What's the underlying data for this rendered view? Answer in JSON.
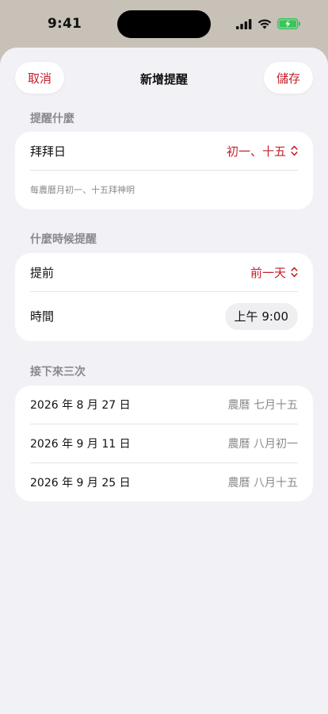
{
  "status": {
    "time": "9:41"
  },
  "nav": {
    "cancel_label": "取消",
    "title": "新增提醒",
    "save_label": "儲存"
  },
  "what_section": {
    "header": "提醒什麼",
    "row_label": "拜拜日",
    "row_value": "初一、十五",
    "hint": "每農曆月初一、十五拜神明"
  },
  "when_section": {
    "header": "什麼時候提醒",
    "advance_label": "提前",
    "advance_value": "前一天",
    "time_label": "時間",
    "time_value": "上午 9:00"
  },
  "next_section": {
    "header": "接下來三次",
    "items": [
      {
        "date": "2026 年 8 月 27 日",
        "lunar": "農曆 七月十五"
      },
      {
        "date": "2026 年 9 月 11 日",
        "lunar": "農曆 八月初一"
      },
      {
        "date": "2026 年 9 月 25 日",
        "lunar": "農曆 八月十五"
      }
    ]
  },
  "colors": {
    "accent": "#c0202b",
    "background": "#f2f1f6",
    "card": "#ffffff",
    "secondary_text": "#8a8a8e",
    "battery": "#34c759"
  }
}
